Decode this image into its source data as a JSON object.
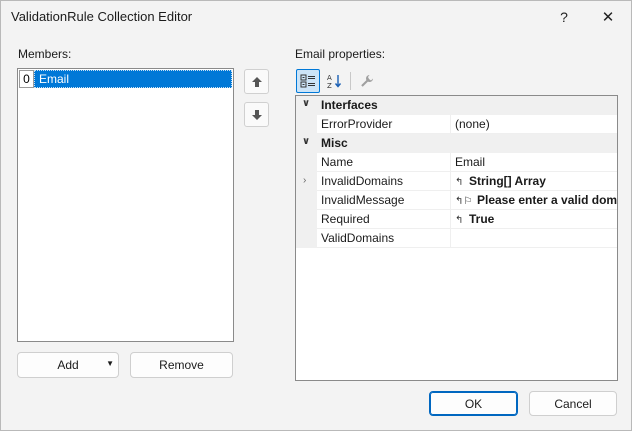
{
  "window": {
    "title": "ValidationRule Collection Editor",
    "help_glyph": "?",
    "close_glyph": "✕"
  },
  "members": {
    "label": "Members:",
    "items": [
      {
        "index": "0",
        "name": "Email"
      }
    ],
    "up_icon": "arrow-up-icon",
    "down_icon": "arrow-down-icon"
  },
  "buttons": {
    "add": "Add",
    "remove": "Remove",
    "ok": "OK",
    "cancel": "Cancel"
  },
  "properties": {
    "label": "Email properties:",
    "toolbar": {
      "categorized_icon": "categorized-icon",
      "alphabetical_icon": "alphabetical-icon",
      "property_pages_icon": "wrench-icon"
    },
    "categories": [
      {
        "name": "Interfaces",
        "rows": [
          {
            "name": "ErrorProvider",
            "value": "(none)",
            "bold": false,
            "marks": "",
            "expandable": false
          }
        ]
      },
      {
        "name": "Misc",
        "rows": [
          {
            "name": "Name",
            "value": "Email",
            "bold": false,
            "marks": "",
            "expandable": false
          },
          {
            "name": "InvalidDomains",
            "value": "String[] Array",
            "bold": true,
            "marks": "↰",
            "expandable": true
          },
          {
            "name": "InvalidMessage",
            "value": "Please enter a valid domain.",
            "bold": true,
            "marks": "↰⚐",
            "expandable": false
          },
          {
            "name": "Required",
            "value": "True",
            "bold": true,
            "marks": "↰",
            "expandable": false
          },
          {
            "name": "ValidDomains",
            "value": "",
            "bold": false,
            "marks": "",
            "expandable": false
          }
        ]
      }
    ]
  },
  "colors": {
    "selection": "#0078d7",
    "accent": "#0067c0"
  }
}
